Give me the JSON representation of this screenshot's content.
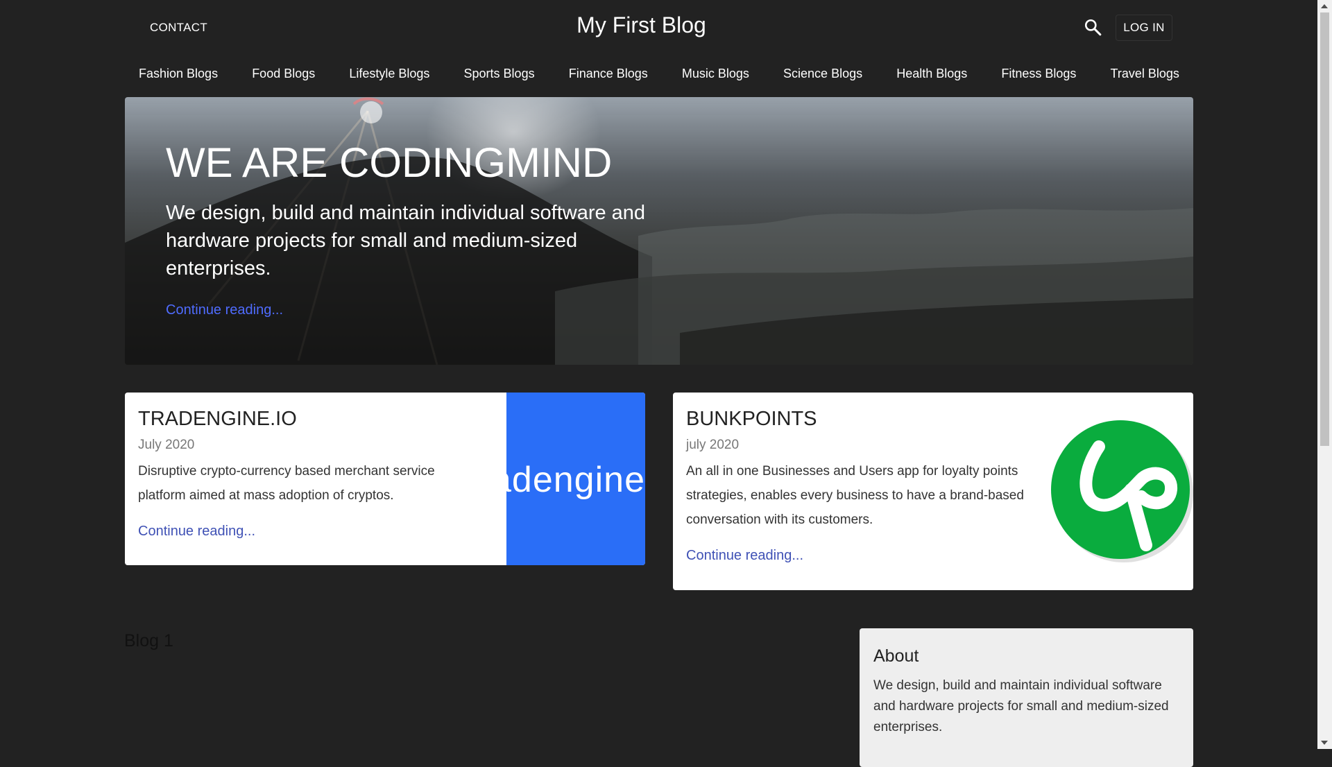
{
  "header": {
    "contact": "CONTACT",
    "brand": "My First Blog",
    "login": "LOG IN"
  },
  "nav": {
    "items": [
      "Fashion Blogs",
      "Food Blogs",
      "Lifestyle Blogs",
      "Sports Blogs",
      "Finance Blogs",
      "Music Blogs",
      "Science Blogs",
      "Health Blogs",
      "Fitness Blogs",
      "Travel Blogs"
    ]
  },
  "hero": {
    "title": "WE ARE CODINGMIND",
    "lead": "We design, build and maintain individual software and hardware projects for small and medium-sized enterprises.",
    "link": "Continue reading..."
  },
  "cards": [
    {
      "title": "TRADENGINE.IO",
      "date": "July 2020",
      "text": "Disruptive crypto-currency based merchant service platform aimed at mass adoption of cryptos.",
      "link": "Continue reading...",
      "image_text": "adengine"
    },
    {
      "title": "BUNKPOINTS",
      "date": "july 2020",
      "text": "An all in one Businesses and Users app for loyalty points strategies, enables every business to have a brand-based conversation with its customers.",
      "link": "Continue reading..."
    }
  ],
  "main": {
    "section_title": "Blog 1"
  },
  "sidebar": {
    "about_title": "About",
    "about_text": "We design, build and maintain individual software and hardware projects for small and medium-sized enterprises."
  },
  "colors": {
    "background": "#222222",
    "link": "#3f51b5",
    "tradengine_blue": "#2a6ef7",
    "bunkpoints_green": "#0aac3e"
  }
}
